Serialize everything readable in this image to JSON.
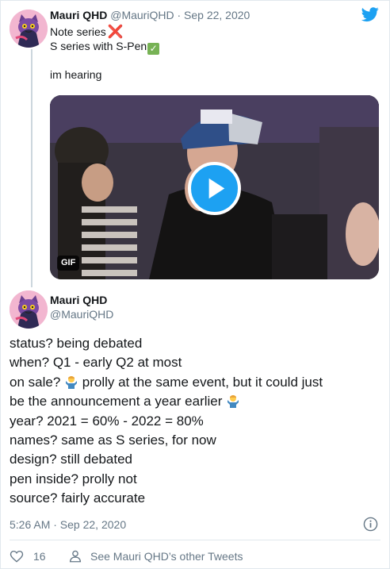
{
  "tweet1": {
    "author_name": "Mauri QHD",
    "handle": "@MauriQHD",
    "separator": "·",
    "date": "Sep 22, 2020",
    "lines": [
      "Note series",
      "S series with S-Pen",
      "",
      "im hearing"
    ],
    "emoji": {
      "cross": "❌",
      "check": "✓"
    },
    "media_badge": "GIF"
  },
  "tweet2": {
    "author_name": "Mauri QHD",
    "handle": "@MauriQHD",
    "lines": [
      "status? being debated",
      "when? Q1 - early Q2 at most",
      "on sale?",
      "prolly at the same event, but it could just",
      "be the announcement a year earlier",
      "year? 2021 = 60% - 2022 = 80%",
      "names? same as S series, for now",
      "design? still debated",
      "pen inside? prolly not",
      "source? fairly accurate"
    ],
    "timestamp": "5:26 AM · Sep 22, 2020"
  },
  "footer": {
    "like_count": "16",
    "profile_link": "See Mauri QHD’s other Tweets"
  },
  "icons": {
    "brand": "twitter-bird-icon",
    "heart": "heart-icon",
    "info": "info-icon",
    "person": "person-icon",
    "play": "play-icon",
    "shrug": "person-shrugging-emoji"
  },
  "colors": {
    "brand_blue": "#1da1f2",
    "text": "#14171a",
    "muted": "#657786",
    "border": "#e1e8ed",
    "thread": "#ccd6dd",
    "cross_red": "#e0245e",
    "check_green": "#77b255"
  }
}
